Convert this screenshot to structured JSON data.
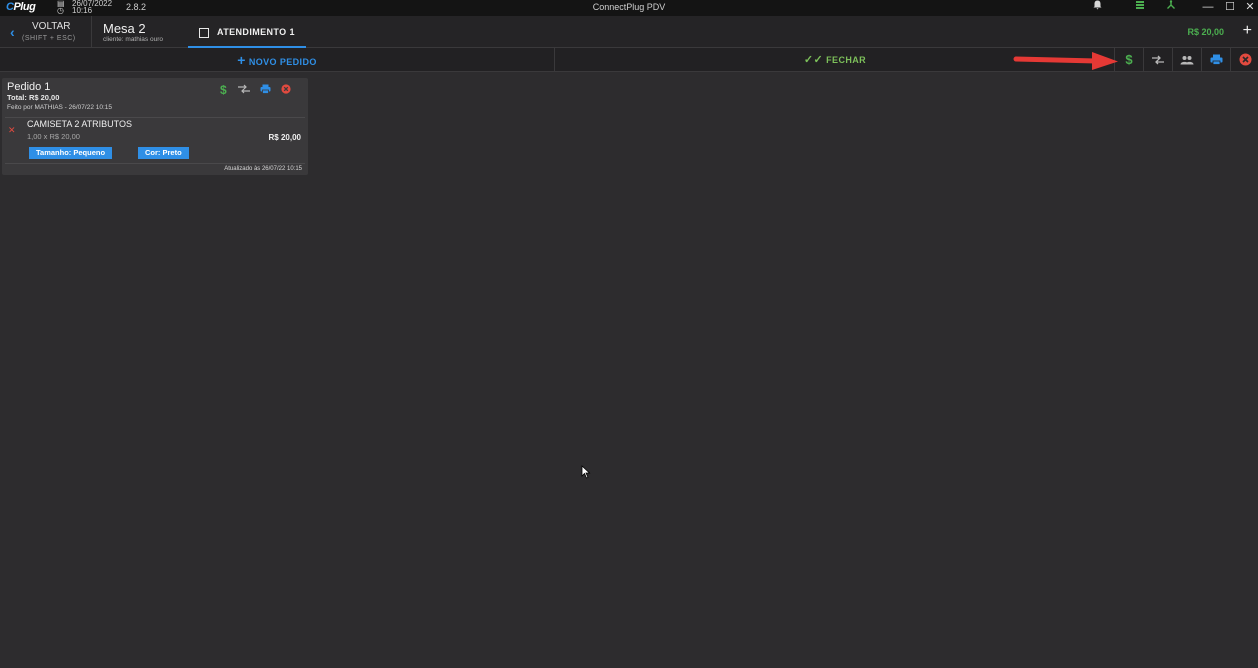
{
  "titlebar": {
    "logo": "CPlug",
    "date": "26/07/2022",
    "time": "10:16",
    "version": "2.8.2",
    "app_title": "ConnectPlug PDV",
    "icons": [
      "bell-icon",
      "server-icon",
      "network-icon"
    ],
    "window_controls": [
      "minimize",
      "maximize",
      "close"
    ]
  },
  "header": {
    "back_label": "VOLTAR",
    "back_hint": "(SHIFT + ESC)",
    "table_name": "Mesa 2",
    "client_label": "cliente: mathias ouro",
    "tab_label": "ATENDIMENTO 1",
    "total": "R$ 20,00",
    "add_label": "+"
  },
  "actionbar": {
    "new_order": "NOVO PEDIDO",
    "close": "FECHAR",
    "buttons": [
      "dollar-icon",
      "transfer-icon",
      "people-icon",
      "print-icon",
      "cancel-icon"
    ]
  },
  "order": {
    "title": "Pedido 1",
    "total": "Total: R$ 20,00",
    "made_by": "Feito por MATHIAS - 26/07/22 10:15",
    "item": {
      "name": "CAMISETA 2 ATRIBUTOS",
      "qty": "1,00 x R$ 20,00",
      "price": "R$ 20,00",
      "attributes": [
        "Tamanho: Pequeno",
        "Cor: Preto"
      ]
    },
    "updated": "Atualizado às 26/07/22 10:15"
  },
  "colors": {
    "accent_blue": "#2f8fe6",
    "green": "#4caf50",
    "red": "#e24a3f",
    "annotation_arrow": "#e53935"
  }
}
